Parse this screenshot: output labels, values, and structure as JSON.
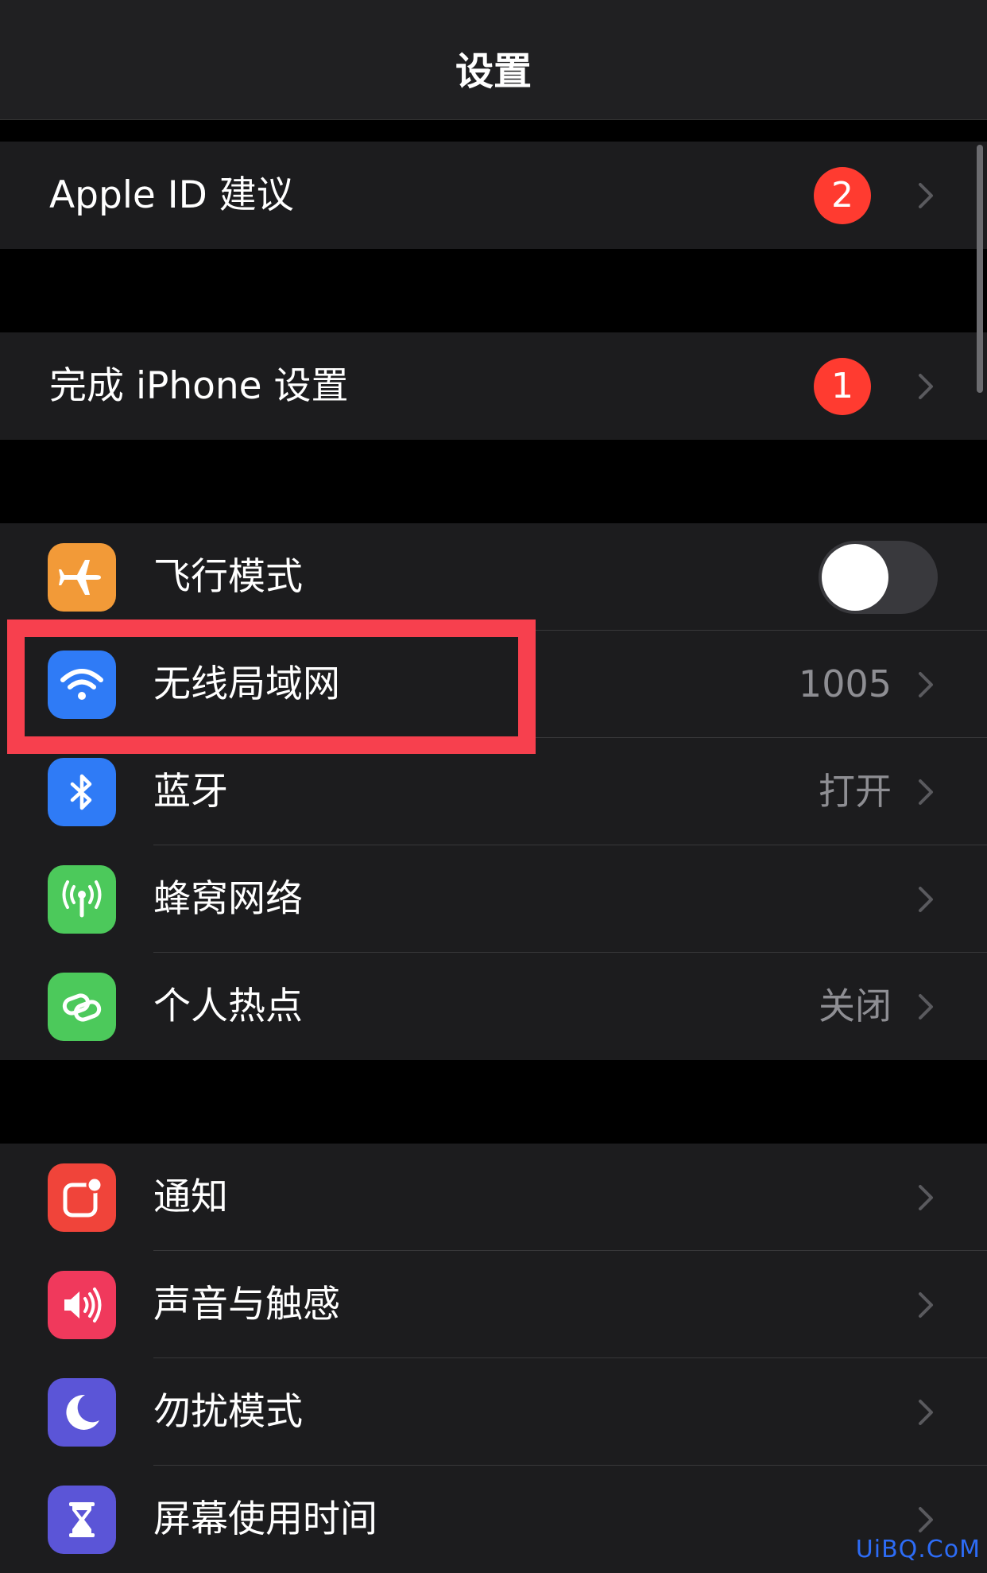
{
  "nav": {
    "title": "设置"
  },
  "group1": {
    "apple_id": {
      "label": "Apple ID 建议",
      "badge": "2"
    }
  },
  "group2": {
    "finish_setup": {
      "label": "完成 iPhone 设置",
      "badge": "1"
    }
  },
  "group3": {
    "airplane": {
      "label": "飞行模式",
      "icon": "airplane-icon",
      "color": "#f29a38",
      "toggle_on": false
    },
    "wifi": {
      "label": "无线局域网",
      "value": "1005",
      "icon": "wifi-icon",
      "color": "#2f7bf6"
    },
    "bluetooth": {
      "label": "蓝牙",
      "value": "打开",
      "icon": "bluetooth-icon",
      "color": "#2f7bf6"
    },
    "cellular": {
      "label": "蜂窝网络",
      "icon": "antenna-icon",
      "color": "#4cc95b"
    },
    "hotspot": {
      "label": "个人热点",
      "value": "关闭",
      "icon": "hotspot-icon",
      "color": "#4cc95b"
    }
  },
  "group4": {
    "notifications": {
      "label": "通知",
      "icon": "notification-icon",
      "color": "#f0443a"
    },
    "sounds": {
      "label": "声音与触感",
      "icon": "speaker-icon",
      "color": "#f0395c"
    },
    "dnd": {
      "label": "勿扰模式",
      "icon": "moon-icon",
      "color": "#5b55d7"
    },
    "screen_time": {
      "label": "屏幕使用时间",
      "icon": "hourglass-icon",
      "color": "#5b55d7"
    }
  },
  "highlight_color": "#f7404e",
  "watermark": "UiBQ.CoM"
}
